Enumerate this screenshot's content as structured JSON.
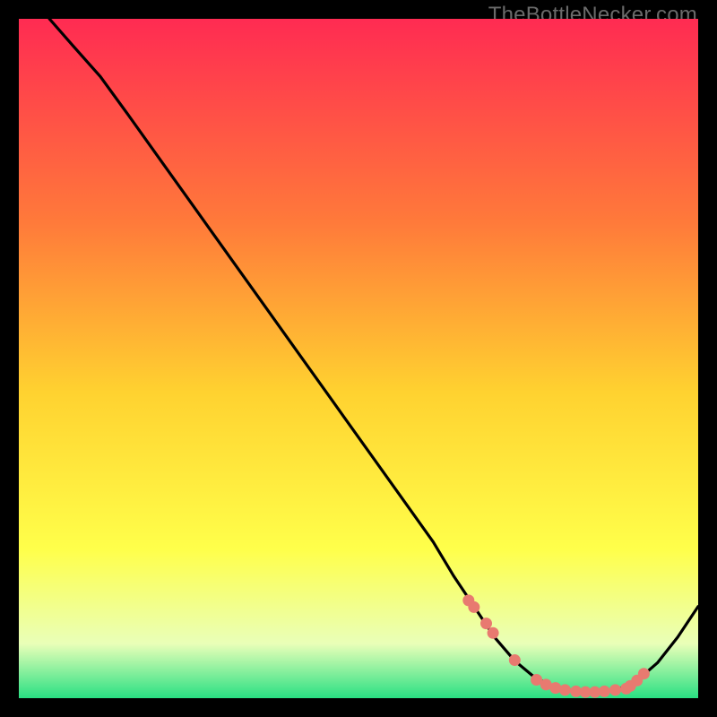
{
  "watermark": "TheBottleNecker.com",
  "colors": {
    "bg": "#000000",
    "gradient_top": "#ff2b52",
    "gradient_mid_upper": "#ff7a3a",
    "gradient_mid": "#ffd230",
    "gradient_mid_lower": "#ffff4a",
    "gradient_lower": "#e9ffb8",
    "gradient_bottom": "#29e083",
    "curve": "#000000",
    "dots": "#e87a70"
  },
  "chart_data": {
    "type": "line",
    "title": "",
    "xlabel": "",
    "ylabel": "",
    "xlim": [
      0,
      100
    ],
    "ylim": [
      0,
      100
    ],
    "grid": false,
    "curve": {
      "name": "bottleneck-curve",
      "x": [
        4.5,
        8,
        12,
        16,
        21,
        26,
        31,
        36,
        41,
        46,
        51,
        56,
        61,
        64,
        67,
        70,
        73,
        76,
        79,
        82,
        85,
        88,
        91,
        94,
        97,
        100
      ],
      "y": [
        100,
        96,
        91.5,
        86,
        79,
        72,
        65,
        58,
        51,
        44,
        37,
        30,
        23,
        18,
        13.5,
        9,
        5.5,
        3,
        1.6,
        1.0,
        0.9,
        1.2,
        2.6,
        5.2,
        9.0,
        13.5
      ]
    },
    "dots": {
      "name": "highlight-dots",
      "points": [
        {
          "x": 66.2,
          "y": 14.4
        },
        {
          "x": 67.0,
          "y": 13.4
        },
        {
          "x": 68.8,
          "y": 11.0
        },
        {
          "x": 69.8,
          "y": 9.6
        },
        {
          "x": 73.0,
          "y": 5.6
        },
        {
          "x": 76.2,
          "y": 2.7
        },
        {
          "x": 77.6,
          "y": 2.0
        },
        {
          "x": 79.0,
          "y": 1.5
        },
        {
          "x": 80.4,
          "y": 1.2
        },
        {
          "x": 82.0,
          "y": 1.0
        },
        {
          "x": 83.4,
          "y": 0.9
        },
        {
          "x": 84.8,
          "y": 0.9
        },
        {
          "x": 86.2,
          "y": 1.0
        },
        {
          "x": 87.8,
          "y": 1.2
        },
        {
          "x": 89.4,
          "y": 1.4
        },
        {
          "x": 90.0,
          "y": 1.8
        },
        {
          "x": 91.0,
          "y": 2.6
        },
        {
          "x": 92.0,
          "y": 3.6
        }
      ]
    }
  }
}
